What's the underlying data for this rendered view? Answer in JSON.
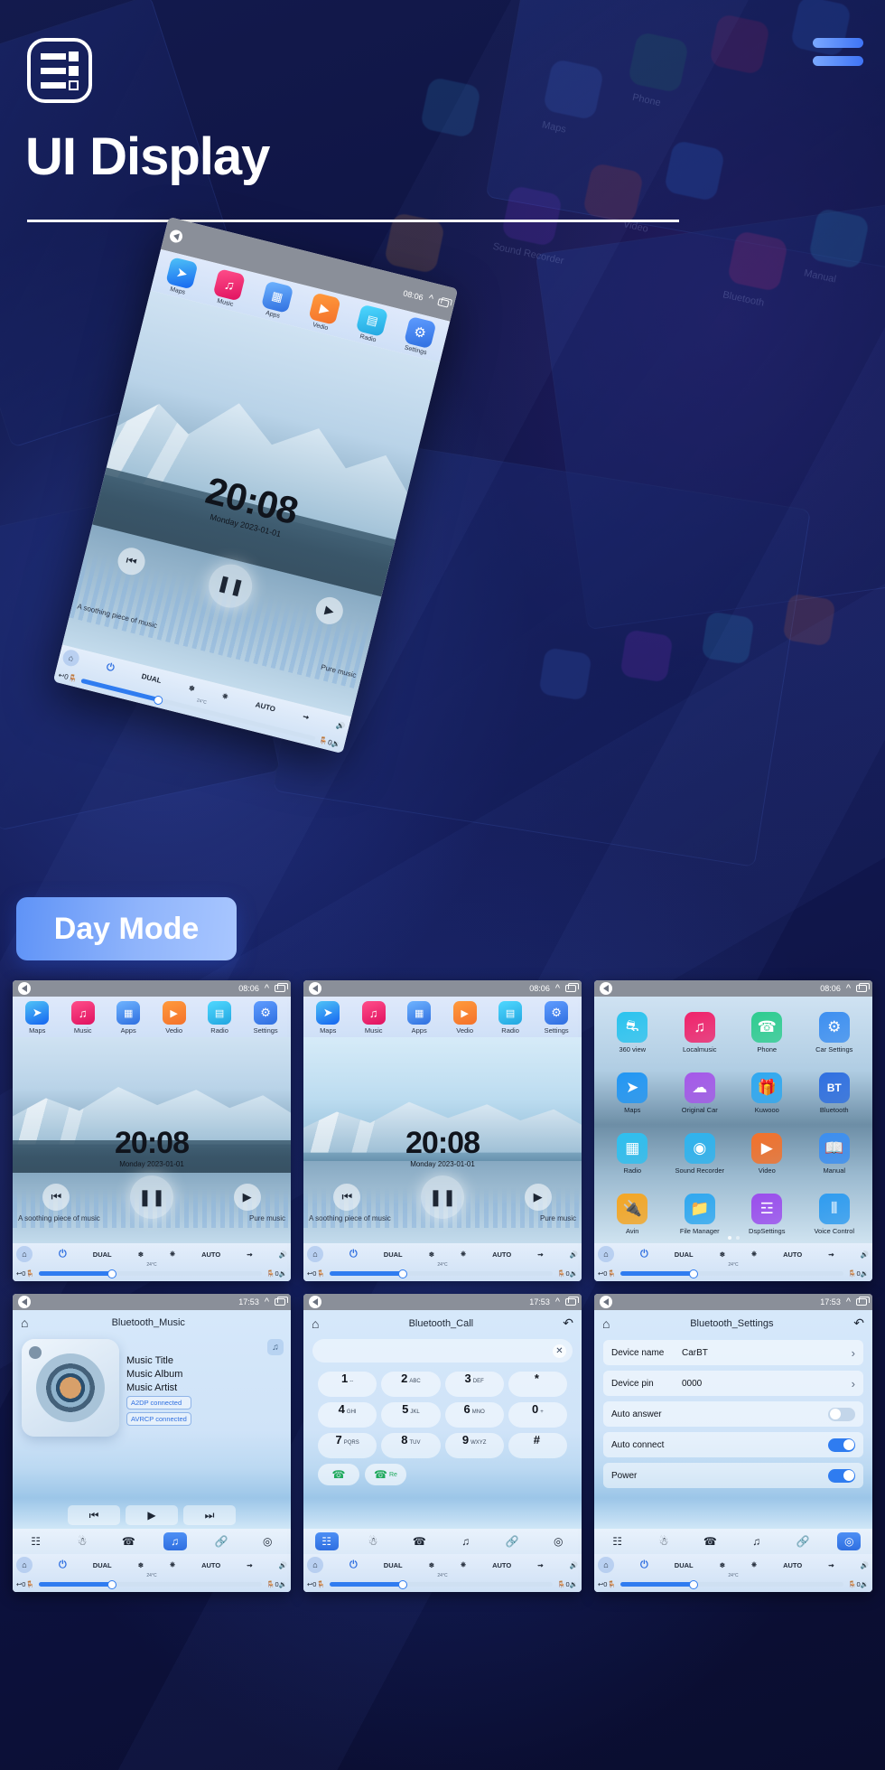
{
  "header": {
    "title": "UI Display",
    "logo_icon": "list-settings-icon",
    "menu_icon": "hamburger-menu-icon"
  },
  "badge": {
    "label": "Day Mode"
  },
  "hero": {
    "status": {
      "back_icon": "back-icon",
      "time": "08:06",
      "chevron_icon": "chevron-up-icon",
      "recents_icon": "recents-icon"
    },
    "apps": [
      {
        "label": "Maps",
        "icon": "navigation-arrow-icon",
        "color": "#2196f3"
      },
      {
        "label": "Music",
        "icon": "music-note-icon",
        "color": "#f0226a"
      },
      {
        "label": "Apps",
        "icon": "grid-squares-icon",
        "color": "#3d8ff0"
      },
      {
        "label": "Vedio",
        "icon": "play-circle-icon",
        "color": "#f4722b"
      },
      {
        "label": "Radio",
        "icon": "radio-icon",
        "color": "#2fc0f0"
      },
      {
        "label": "Settings",
        "icon": "gear-icon",
        "color": "#2f7cf0"
      }
    ],
    "clock": {
      "time": "20:08",
      "date": "Monday  2023-01-01"
    },
    "player": {
      "prev_icon": "previous-track-icon",
      "pause_icon": "pause-icon",
      "next_icon": "next-track-icon",
      "track_title": "A soothing piece of music",
      "mode_label": "Pure music"
    },
    "hvac": {
      "home_icon": "home-icon",
      "power_icon": "power-icon",
      "dual": "DUAL",
      "snow_icon": "snowflake-icon",
      "defrost_icon": "rear-defrost-icon",
      "auto": "AUTO",
      "fan_icon": "airflow-icon",
      "vol_up_icon": "volume-up-icon",
      "back_icon": "back-arrow-icon",
      "left_temp": "0",
      "right_temp": "0",
      "seat_icon": "seat-icon",
      "seat_heat_icon": "seat-heated-icon",
      "vol_down_icon": "volume-down-icon",
      "temp_label": "24°C"
    }
  },
  "cards": {
    "home_a": {
      "name": "home-screen-lake",
      "status": {
        "time": "08:06"
      },
      "apps": [
        {
          "label": "Maps",
          "icon": "navigation-arrow-icon",
          "color": "#2196f3"
        },
        {
          "label": "Music",
          "icon": "music-note-icon",
          "color": "#f0226a"
        },
        {
          "label": "Apps",
          "icon": "grid-squares-icon",
          "color": "#3d8ff0"
        },
        {
          "label": "Vedio",
          "icon": "play-circle-icon",
          "color": "#f4722b"
        },
        {
          "label": "Radio",
          "icon": "radio-icon",
          "color": "#2fc0f0"
        },
        {
          "label": "Settings",
          "icon": "gear-icon",
          "color": "#2f7cf0"
        }
      ],
      "clock": {
        "time": "20:08",
        "date": "Monday  2023-01-01"
      },
      "track_title": "A soothing piece of music",
      "mode_label": "Pure music"
    },
    "home_b": {
      "name": "home-screen-mountain",
      "status": {
        "time": "08:06"
      },
      "clock": {
        "time": "20:08",
        "date": "Monday  2023-01-01"
      },
      "track_title": "A soothing piece of music",
      "mode_label": "Pure music"
    },
    "apps_page": {
      "name": "all-apps-screen",
      "status": {
        "time": "08:06"
      },
      "items": [
        {
          "label": "360 view",
          "icon": "car-360-icon",
          "color": "#2ac3ee"
        },
        {
          "label": "Localmusic",
          "icon": "music-note-icon",
          "color": "#f0226a"
        },
        {
          "label": "Phone",
          "icon": "phone-icon",
          "color": "#2ecc8f"
        },
        {
          "label": "Car Settings",
          "icon": "gear-icon",
          "color": "#3d8ff0"
        },
        {
          "label": "Maps",
          "icon": "navigation-arrow-icon",
          "color": "#2196f3"
        },
        {
          "label": "Original Car",
          "icon": "car-front-icon",
          "color": "#a558e8"
        },
        {
          "label": "Kuwooo",
          "icon": "gift-box-icon",
          "color": "#2fa8f0"
        },
        {
          "label": "Bluetooth",
          "icon": "bluetooth-bt-icon",
          "color": "#2f6fe0"
        },
        {
          "label": "Radio",
          "icon": "radio-icon",
          "color": "#2fc0f0"
        },
        {
          "label": "Sound Recorder",
          "icon": "record-icon",
          "color": "#2fb4ef"
        },
        {
          "label": "Video",
          "icon": "play-circle-icon",
          "color": "#f4722b"
        },
        {
          "label": "Manual",
          "icon": "book-icon",
          "color": "#3d8ff0"
        },
        {
          "label": "Avin",
          "icon": "plug-icon",
          "color": "#f5a623"
        },
        {
          "label": "File Manager",
          "icon": "folder-icon",
          "color": "#2fa8f0"
        },
        {
          "label": "DspSettings",
          "icon": "sliders-icon",
          "color": "#9b4ded"
        },
        {
          "label": "Voice Control",
          "icon": "waveform-icon",
          "color": "#2f9cf0"
        }
      ]
    },
    "bt_music": {
      "name": "bluetooth-music-screen",
      "status": {
        "time": "17:53"
      },
      "title": "Bluetooth_Music",
      "home_icon": "home-icon",
      "meta": [
        "Music Title",
        "Music Album",
        "Music Artist"
      ],
      "chips": [
        "A2DP  connected",
        "AVRCP connected"
      ],
      "controls": [
        "previous-track-icon",
        "play-icon",
        "next-track-icon"
      ],
      "toolbar": [
        "dialpad-icon",
        "contacts-icon",
        "phone-icon",
        "music-icon",
        "link-icon",
        "settings-icon"
      ],
      "active_tool": 3
    },
    "bt_call": {
      "name": "bluetooth-call-screen",
      "status": {
        "time": "17:53"
      },
      "title": "Bluetooth_Call",
      "home_icon": "home-icon",
      "back_icon": "undo-icon",
      "input_value": "",
      "clear_icon": "clear-x-icon",
      "keys": [
        {
          "n": "1",
          "s": "--"
        },
        {
          "n": "2",
          "s": "ABC"
        },
        {
          "n": "3",
          "s": "DEF"
        },
        {
          "n": "*",
          "s": ""
        },
        {
          "n": "4",
          "s": "GHI"
        },
        {
          "n": "5",
          "s": "JKL"
        },
        {
          "n": "6",
          "s": "MNO"
        },
        {
          "n": "0",
          "s": "+"
        },
        {
          "n": "7",
          "s": "PQRS"
        },
        {
          "n": "8",
          "s": "TUV"
        },
        {
          "n": "9",
          "s": "WXYZ"
        },
        {
          "n": "#",
          "s": ""
        }
      ],
      "call_label": "",
      "redial_label": "Re",
      "toolbar": [
        "dialpad-icon",
        "contacts-icon",
        "phone-icon",
        "music-icon",
        "link-icon",
        "settings-icon"
      ],
      "active_tool": 0
    },
    "bt_settings": {
      "name": "bluetooth-settings-screen",
      "status": {
        "time": "17:53"
      },
      "title": "Bluetooth_Settings",
      "home_icon": "home-icon",
      "back_icon": "undo-icon",
      "rows": [
        {
          "key": "Device name",
          "value": "CarBT",
          "type": "chevron"
        },
        {
          "key": "Device pin",
          "value": "0000",
          "type": "chevron"
        },
        {
          "key": "Auto answer",
          "value": "",
          "type": "toggle",
          "on": false
        },
        {
          "key": "Auto connect",
          "value": "",
          "type": "toggle",
          "on": true
        },
        {
          "key": "Power",
          "value": "",
          "type": "toggle",
          "on": true
        }
      ],
      "toolbar": [
        "dialpad-icon",
        "contacts-icon",
        "phone-icon",
        "music-icon",
        "link-icon",
        "settings-icon"
      ],
      "active_tool": 5
    }
  },
  "hvac_common": {
    "dual": "DUAL",
    "auto": "AUTO",
    "temp_label": "24°C",
    "left_temp": "0",
    "right_temp": "0"
  },
  "colors": {
    "accent": "#2f7cf0",
    "badge_from": "#5f93f7",
    "badge_to": "#a8c6ff",
    "bg": "#0d1035"
  }
}
